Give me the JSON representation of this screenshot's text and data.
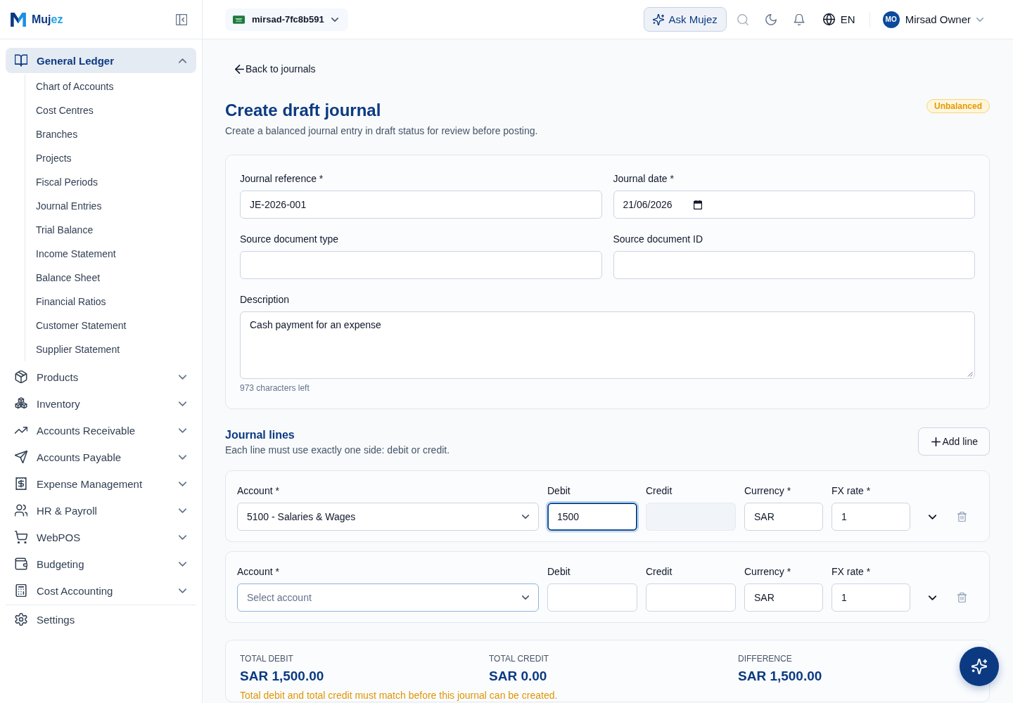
{
  "brand": {
    "name": "Muj",
    "name_accent": "ez"
  },
  "sidebar": {
    "items": [
      {
        "label": "General Ledger",
        "selected": true,
        "expanded": true,
        "children": [
          {
            "label": "Chart of Accounts",
            "selected": false
          },
          {
            "label": "Cost Centres",
            "selected": false
          },
          {
            "label": "Branches",
            "selected": false
          },
          {
            "label": "Projects",
            "selected": false
          },
          {
            "label": "Fiscal Periods",
            "selected": false
          },
          {
            "label": "Journal Entries",
            "selected": false
          },
          {
            "label": "Trial Balance",
            "selected": false
          },
          {
            "label": "Income Statement",
            "selected": false
          },
          {
            "label": "Balance Sheet",
            "selected": false
          },
          {
            "label": "Financial Ratios",
            "selected": false
          },
          {
            "label": "Customer Statement",
            "selected": false
          },
          {
            "label": "Supplier Statement",
            "selected": false
          }
        ]
      },
      {
        "label": "Products",
        "selected": false,
        "expanded": false
      },
      {
        "label": "Inventory",
        "selected": false,
        "expanded": false
      },
      {
        "label": "Accounts Receivable",
        "selected": false,
        "expanded": false
      },
      {
        "label": "Accounts Payable",
        "selected": false,
        "expanded": false
      },
      {
        "label": "Expense Management",
        "selected": false,
        "expanded": false
      },
      {
        "label": "HR & Payroll",
        "selected": false,
        "expanded": false
      },
      {
        "label": "WebPOS",
        "selected": false,
        "expanded": false
      },
      {
        "label": "Budgeting",
        "selected": false,
        "expanded": false
      },
      {
        "label": "Cost Accounting",
        "selected": false,
        "expanded": false
      }
    ],
    "footer_items": [
      {
        "label": "Settings",
        "selected": false
      }
    ]
  },
  "topbar": {
    "organization": "mirsad-7fc8b591",
    "ask_button": "Ask Mujez",
    "language": "EN",
    "user": {
      "initials": "MO",
      "name": "Mirsad Owner"
    }
  },
  "page": {
    "back_link": "Back to journals",
    "title": "Create draft journal",
    "subtitle": "Create a balanced journal entry in draft status for review before posting.",
    "status_badge": "Unbalanced"
  },
  "form": {
    "fields": [
      {
        "kind": "text",
        "label": "Journal reference *",
        "value": "JE-2026-001"
      },
      {
        "kind": "date",
        "label": "Journal date *",
        "value": "21/06/2026"
      },
      {
        "kind": "text",
        "label": "Source document type"
      },
      {
        "kind": "text",
        "label": "Source document ID"
      },
      {
        "kind": "textarea",
        "label": "Description",
        "value": "Cash payment for an expense",
        "counter": "973 characters left"
      }
    ]
  },
  "journal_lines": {
    "title": "Journal lines",
    "subtitle": "Each line must use exactly one side: debit or credit.",
    "add_button": "Add line",
    "lines": [
      {
        "account": {
          "label": "Account *",
          "value": "5100 - Salaries & Wages",
          "hovered": false
        },
        "debit": {
          "label": "Debit",
          "value": "1500",
          "focused": true
        },
        "credit": {
          "label": "Credit",
          "disabled": true
        },
        "currency": {
          "label": "Currency *",
          "value": "SAR"
        },
        "fx_rate": {
          "label": "FX rate *",
          "value": "1"
        },
        "expanded": false
      },
      {
        "account": {
          "label": "Account *",
          "placeholder": "Select account",
          "hovered": true
        },
        "debit": {
          "label": "Debit",
          "focused": false
        },
        "credit": {
          "label": "Credit",
          "disabled": false
        },
        "currency": {
          "label": "Currency *",
          "value": "SAR"
        },
        "fx_rate": {
          "label": "FX rate *",
          "value": "1"
        },
        "expanded": false
      }
    ]
  },
  "summary": {
    "totals": [
      {
        "label": "TOTAL DEBIT",
        "value": "SAR 1,500.00"
      },
      {
        "label": "TOTAL CREDIT",
        "value": "SAR 0.00"
      },
      {
        "label": "DIFFERENCE",
        "value": "SAR 1,500.00"
      }
    ],
    "warning": "Total debit and total credit must match before this journal can be created."
  }
}
